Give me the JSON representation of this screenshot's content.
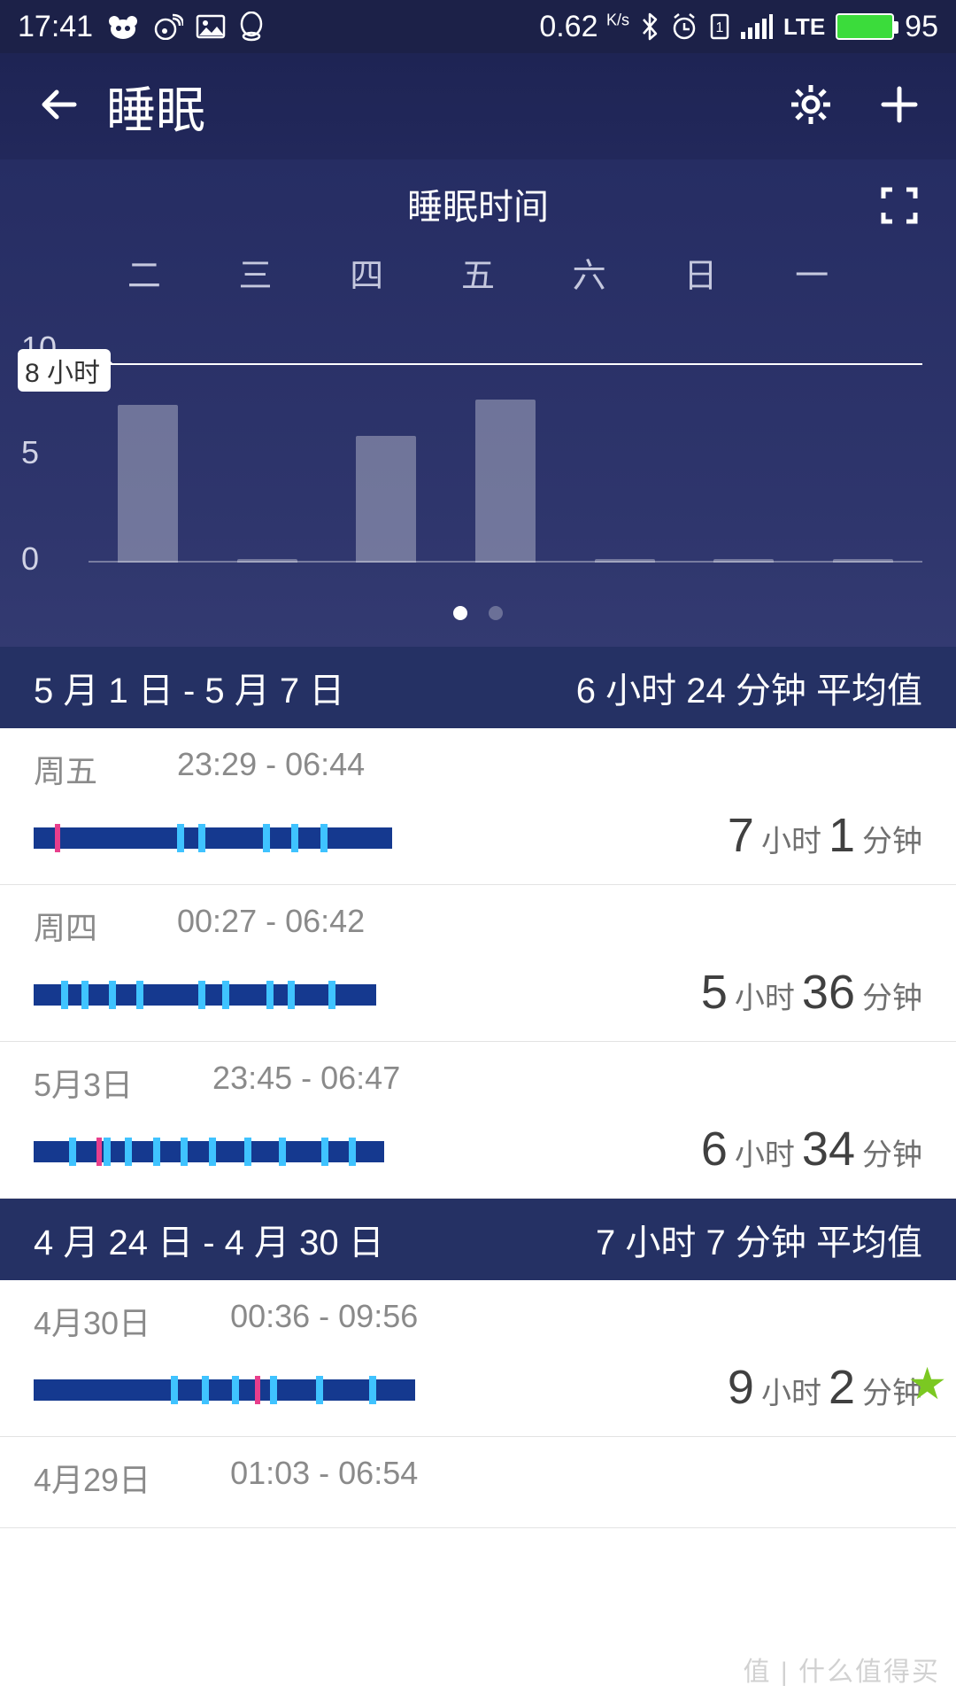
{
  "status_bar": {
    "time": "17:41",
    "net_speed": "0.62",
    "net_unit": "K/s",
    "lte": "LTE",
    "battery": "95"
  },
  "header": {
    "title": "睡眠"
  },
  "chart_data": {
    "type": "bar",
    "title": "睡眠时间",
    "categories": [
      "二",
      "三",
      "四",
      "五",
      "六",
      "日",
      "一"
    ],
    "values": [
      7.0,
      0.1,
      5.6,
      7.2,
      0.1,
      0.1,
      0.1
    ],
    "ylim": [
      0,
      10
    ],
    "yticks": [
      0,
      5,
      10
    ],
    "goal_label": "8 小时",
    "goal_value": 8,
    "ylabel": "",
    "xlabel": "",
    "page_dots": 2,
    "active_dot": 0
  },
  "weeks": [
    {
      "range": "5 月 1 日 - 5 月 7 日",
      "avg": "6 小时 24 分钟 平均值",
      "days": [
        {
          "label": "周五",
          "span": "23:29 - 06:44",
          "h": "7",
          "hu": "小时",
          "m": "1",
          "mu": "分钟",
          "fill": 0.92,
          "starred": false
        },
        {
          "label": "周四",
          "span": "00:27 - 06:42",
          "h": "5",
          "hu": "小时",
          "m": "36",
          "mu": "分钟",
          "fill": 0.88,
          "starred": false
        },
        {
          "label": "5月3日",
          "span": "23:45 - 06:47",
          "h": "6",
          "hu": "小时",
          "m": "34",
          "mu": "分钟",
          "fill": 0.9,
          "starred": false
        }
      ]
    },
    {
      "range": "4 月 24 日 - 4 月 30 日",
      "avg": "7 小时 7 分钟 平均值",
      "days": [
        {
          "label": "4月30日",
          "span": "00:36 - 09:56",
          "h": "9",
          "hu": "小时",
          "m": "2",
          "mu": "分钟",
          "fill": 0.98,
          "starred": true
        },
        {
          "label": "4月29日",
          "span": "01:03 - 06:54",
          "h": "",
          "hu": "",
          "m": "",
          "mu": "",
          "fill": 0,
          "starred": false,
          "compact": true
        }
      ]
    }
  ],
  "watermark": "值 | 什么值得买"
}
